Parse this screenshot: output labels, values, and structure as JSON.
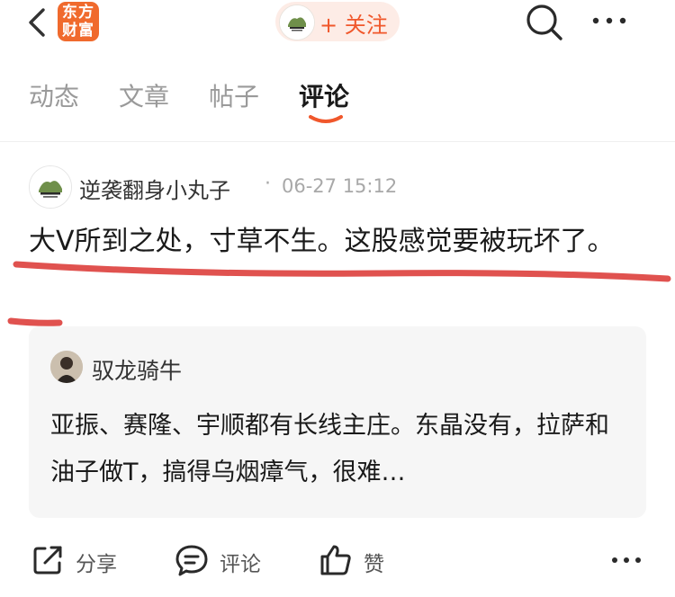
{
  "header": {
    "logo_line1": "东方",
    "logo_line2": "财富",
    "follow_label": "+ 关注",
    "accent_color": "#f0572b"
  },
  "tabs": [
    {
      "label": "动态",
      "active": false
    },
    {
      "label": "文章",
      "active": false
    },
    {
      "label": "帖子",
      "active": false
    },
    {
      "label": "评论",
      "active": true
    }
  ],
  "post": {
    "username": "逆袭翻身小丸子",
    "separator": "·",
    "timestamp": "06-27 15:12",
    "text": "大V所到之处，寸草不生。这股感觉要被玩坏了。"
  },
  "quote": {
    "username": "驭龙骑牛",
    "text": "亚振、赛隆、宇顺都有长线主庄。东晶没有，拉萨和油子做T，搞得乌烟瘴气，很难…"
  },
  "actions": {
    "share_label": "分享",
    "comment_label": "评论",
    "like_label": "赞"
  },
  "icons": [
    "back-icon",
    "search-icon",
    "more-icon",
    "share-icon",
    "comment-icon",
    "thumbs-up-icon"
  ]
}
